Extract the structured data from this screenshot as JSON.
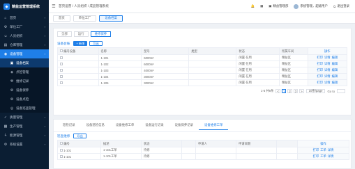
{
  "app": {
    "title": "精益运营管理系统"
  },
  "colors": {
    "accent": "#1f7fe8",
    "sidebar_bg": "#0b1e33"
  },
  "header": {
    "crumb": "首页运营 / 人员组织 / 成品管理系统",
    "items": [
      {
        "icon": "bell-icon",
        "label": ""
      },
      {
        "icon": "grid-icon",
        "label": ""
      },
      {
        "icon": "org-icon",
        "label": "精益管理部"
      },
      {
        "icon": "user-icon",
        "label": "系统管理，超级用户"
      },
      {
        "icon": "power-icon",
        "label": "退出登录"
      }
    ]
  },
  "sidebar": {
    "items": [
      {
        "label": "首页",
        "icon": "⌂"
      },
      {
        "label": "单位工厂",
        "icon": "⚙"
      },
      {
        "label": "人员组织",
        "icon": "☺"
      },
      {
        "label": "仓库管理",
        "icon": "▤"
      },
      {
        "label": "设备管理",
        "icon": "◉",
        "active": true
      },
      {
        "label": "设备档案",
        "icon": "▣",
        "sub": true,
        "current": true
      },
      {
        "label": "点检管理",
        "icon": "◈",
        "sub": true
      },
      {
        "label": "维修记录",
        "icon": "⚒",
        "sub": true
      },
      {
        "label": "设备保养",
        "icon": "⚙",
        "sub": true
      },
      {
        "label": "设备点检",
        "icon": "⚙",
        "sub": true
      },
      {
        "label": "设备巡查管理",
        "icon": "◎",
        "sub": true
      },
      {
        "label": "质量管理",
        "icon": "✓"
      },
      {
        "label": "生产管理",
        "icon": "▦"
      },
      {
        "label": "能源管理",
        "icon": "ϟ"
      },
      {
        "label": "系统设置",
        "icon": "⚙"
      }
    ]
  },
  "page_tabs": [
    {
      "label": "首页",
      "on": false
    },
    {
      "label": "单位工厂",
      "on": false
    },
    {
      "label": "设备档案",
      "on": true
    }
  ],
  "upper": {
    "subtabs": [
      {
        "label": "全部",
        "on": false
      },
      {
        "label": "运行",
        "on": false
      },
      {
        "label": "维修保养",
        "on": true
      }
    ],
    "title": "设备台账",
    "btn_add": "+ 新增",
    "btn_export": "导出",
    "columns": [
      "编号设备",
      "名称",
      "型号",
      "类型",
      "状态",
      "所属车间",
      "操作"
    ],
    "rows": [
      {
        "code": "",
        "name": "1-101",
        "model": "6000m²",
        "type": "",
        "status": "闲置 在用",
        "shop": "精益区"
      },
      {
        "code": "",
        "name": "1-102",
        "model": "6000m²",
        "type": "",
        "status": "闲置 在用",
        "shop": "精益区"
      },
      {
        "code": "",
        "name": "1-103",
        "model": "4000m²",
        "type": "",
        "status": "闲置 在用",
        "shop": "精益区"
      },
      {
        "code": "",
        "name": "1-104",
        "model": "3000m²",
        "type": "",
        "status": "闲置 在用",
        "shop": "精益区"
      },
      {
        "code": "",
        "name": "1-105",
        "model": "3000m²",
        "type": "",
        "status": "闲置 在用",
        "shop": "精益区"
      }
    ],
    "op": [
      "打印",
      "详情",
      "编辑"
    ],
    "pager": {
      "total": "1-5 共5条",
      "pages": [
        "<",
        "1",
        "2",
        "3",
        ">"
      ],
      "size": "10条/page",
      "goto": "Go to"
    }
  },
  "lower": {
    "tabs": [
      {
        "label": "巡检记录",
        "on": false
      },
      {
        "label": "设备巡检信息",
        "on": false
      },
      {
        "label": "设备维修工单",
        "on": false
      },
      {
        "label": "设备运行记录",
        "on": false
      },
      {
        "label": "设备保养记录",
        "on": false
      },
      {
        "label": "设备维修工单",
        "on": true
      }
    ],
    "title": "巡查维修",
    "btn_export": "导出",
    "columns": [
      "编号",
      "描述",
      "状态",
      "",
      "申请人",
      "申请日期",
      "",
      "操作"
    ],
    "rows": [
      {
        "code": "1-101",
        "desc": "1-101工单",
        "status": "待修"
      },
      {
        "code": "1-101",
        "desc": "1-101工单",
        "status": "待修"
      }
    ],
    "op": [
      "打印",
      "工单",
      "详情"
    ]
  }
}
